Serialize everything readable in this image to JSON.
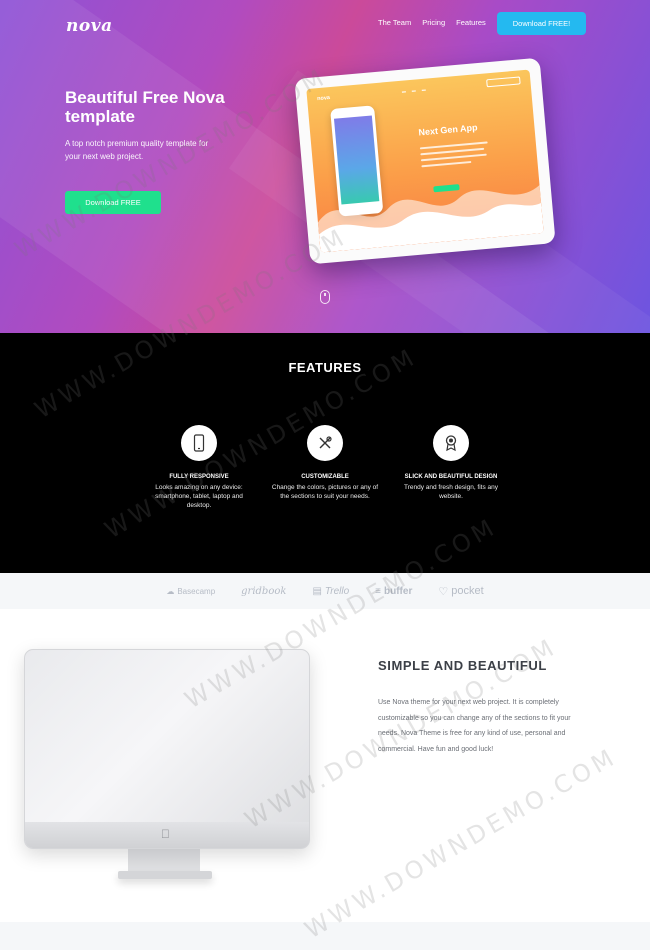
{
  "header": {
    "logo": "nova",
    "nav": [
      "The Team",
      "Pricing",
      "Features"
    ],
    "cta_label": "Download FREE!"
  },
  "hero": {
    "title": "Beautiful Free Nova template",
    "subtitle": "A top notch premium quality template for your next web project.",
    "button_label": "Download FREE",
    "mockup_title": "Next Gen App"
  },
  "features": {
    "title": "FEATURES",
    "items": [
      {
        "title": "FULLY RESPONSIVE",
        "description": "Looks amazing on any device: smartphone, tablet, laptop and desktop.",
        "icon": "smartphone-icon"
      },
      {
        "title": "CUSTOMIZABLE",
        "description": "Change the colors, pictures or any of the sections to suit your needs.",
        "icon": "tools-icon"
      },
      {
        "title": "SLICK AND BEAUTIFUL DESIGN",
        "description": "Trendy and fresh design, fits any website.",
        "icon": "award-icon"
      }
    ]
  },
  "brands": [
    "Basecamp",
    "gridbook",
    "Trello",
    "buffer",
    "pocket"
  ],
  "simple": {
    "title": "SIMPLE AND BEAUTIFUL",
    "text": "Use Nova theme for your next web project. It is completely customizable so you can change any of the sections to fit your needs. Nova Theme is free for any kind of use, personal and commercial. Have fun and good luck!"
  },
  "watermark": "WWW.DOWNDEMO.COM",
  "colors": {
    "hero_gradient_start": "#8e52d6",
    "hero_gradient_end": "#6d55e0",
    "nav_cta": "#24b9f0",
    "hero_button": "#1fe08d",
    "features_bg": "#000000",
    "brand_text": "#b6bcc6"
  }
}
